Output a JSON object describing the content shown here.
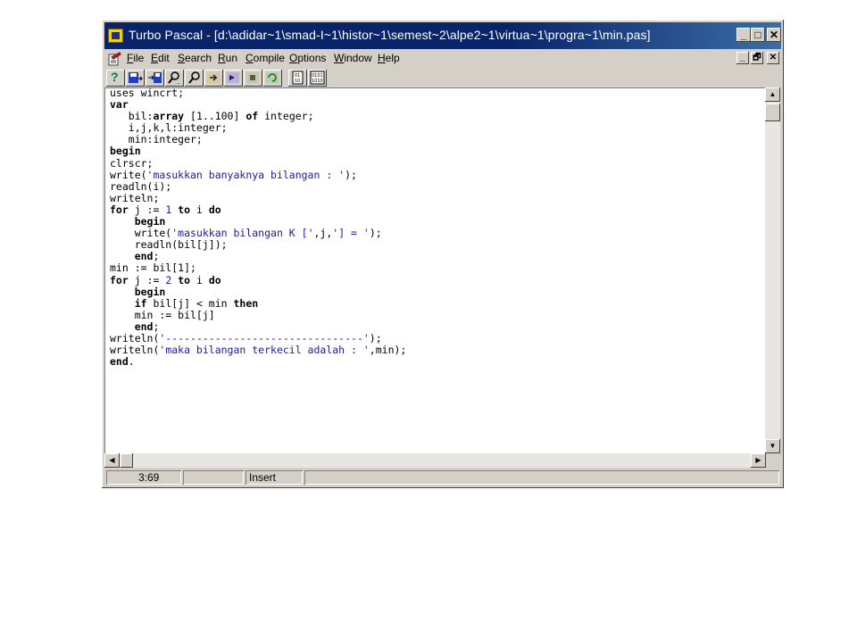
{
  "window": {
    "title": "Turbo Pascal - [d:\\adidar~1\\smad-I~1\\histor~1\\semest~2\\alpe2~1\\virtua~1\\progra~1\\min.pas]",
    "minimize_label": "_",
    "maximize_label": "□",
    "close_label": "✕"
  },
  "menu": {
    "items": [
      {
        "accel": "F",
        "rest": "ile"
      },
      {
        "accel": "E",
        "rest": "dit"
      },
      {
        "accel": "S",
        "rest": "earch"
      },
      {
        "accel": "R",
        "rest": "un"
      },
      {
        "accel": "C",
        "rest": "ompile"
      },
      {
        "accel": "O",
        "rest": "ptions"
      },
      {
        "accel": "W",
        "rest": "indow"
      },
      {
        "accel": "H",
        "rest": "elp"
      }
    ],
    "mdi_min": "_",
    "mdi_restore": "🗗",
    "mdi_close": "✕"
  },
  "toolbar": {
    "help_label": "?",
    "tools": [
      "help-icon",
      "save-icon",
      "save-all-icon",
      "find-icon",
      "find-next-icon",
      "step-over-icon",
      "trace-into-icon",
      "run-to-cursor-icon",
      "reset-icon",
      "compile-icon",
      "make-icon"
    ]
  },
  "editor": {
    "lines": [
      [
        [
          "t",
          "uses wincrt;"
        ]
      ],
      [
        [
          "k",
          "var"
        ]
      ],
      [
        [
          "t",
          "   bil:"
        ],
        [
          "k",
          "array"
        ],
        [
          "t",
          " [1..100] "
        ],
        [
          "k",
          "of"
        ],
        [
          "t",
          " integer;"
        ]
      ],
      [
        [
          "t",
          "   i,j,k,l:integer;"
        ]
      ],
      [
        [
          "t",
          "   min:integer;"
        ]
      ],
      [
        [
          "k",
          "begin"
        ]
      ],
      [
        [
          "t",
          "clrscr;"
        ]
      ],
      [
        [
          "t",
          "write("
        ],
        [
          "s",
          "'masukkan banyaknya bilangan : '"
        ],
        [
          "t",
          ");"
        ]
      ],
      [
        [
          "t",
          "readln(i);"
        ]
      ],
      [
        [
          "t",
          "writeln;"
        ]
      ],
      [
        [
          "k",
          "for"
        ],
        [
          "t",
          " j := "
        ],
        [
          "n",
          "1"
        ],
        [
          "t",
          " "
        ],
        [
          "k",
          "to"
        ],
        [
          "t",
          " i "
        ],
        [
          "k",
          "do"
        ]
      ],
      [
        [
          "t",
          "    "
        ],
        [
          "k",
          "begin"
        ]
      ],
      [
        [
          "t",
          "    write("
        ],
        [
          "s",
          "'masukkan bilangan K ['"
        ],
        [
          "t",
          ",j,"
        ],
        [
          "s",
          "'] = '"
        ],
        [
          "t",
          ");"
        ]
      ],
      [
        [
          "t",
          "    readln(bil[j]);"
        ]
      ],
      [
        [
          "t",
          "    "
        ],
        [
          "k",
          "end"
        ],
        [
          "t",
          ";"
        ]
      ],
      [
        [
          "t",
          "min := bil[1];"
        ]
      ],
      [
        [
          "k",
          "for"
        ],
        [
          "t",
          " j := "
        ],
        [
          "n",
          "2"
        ],
        [
          "t",
          " "
        ],
        [
          "k",
          "to"
        ],
        [
          "t",
          " i "
        ],
        [
          "k",
          "do"
        ]
      ],
      [
        [
          "t",
          "    "
        ],
        [
          "k",
          "begin"
        ]
      ],
      [
        [
          "t",
          "    "
        ],
        [
          "k",
          "if"
        ],
        [
          "t",
          " bil[j] < min "
        ],
        [
          "k",
          "then"
        ]
      ],
      [
        [
          "t",
          "    min := bil[j]"
        ]
      ],
      [
        [
          "t",
          "    "
        ],
        [
          "k",
          "end"
        ],
        [
          "t",
          ";"
        ]
      ],
      [
        [
          "t",
          "writeln("
        ],
        [
          "s",
          "'--------------------------------'"
        ],
        [
          "t",
          ");"
        ]
      ],
      [
        [
          "t",
          "writeln("
        ],
        [
          "s",
          "'maka bilangan terkecil adalah : '"
        ],
        [
          "t",
          ",min);"
        ]
      ],
      [
        [
          "k",
          "end"
        ],
        [
          "t",
          "."
        ]
      ]
    ]
  },
  "scrollbars": {
    "up_arrow": "▲",
    "down_arrow": "▼",
    "left_arrow": "◀",
    "right_arrow": "▶"
  },
  "status": {
    "position": "3:69",
    "modified": "",
    "mode": "Insert"
  }
}
